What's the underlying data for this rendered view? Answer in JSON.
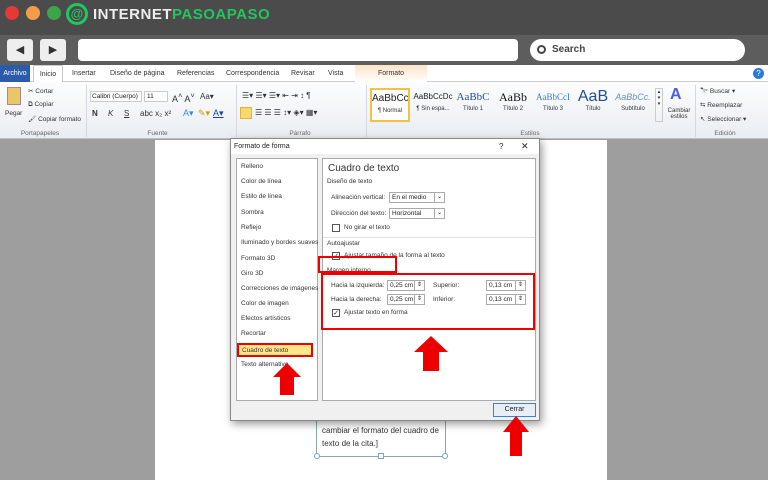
{
  "brand": {
    "logo_text_white": "INTERNET",
    "logo_text_green": "PASOAPASO",
    "green": "#22c55e"
  },
  "browser": {
    "search_label": "Search",
    "back_icon": "back-arrow-icon",
    "forward_icon": "forward-arrow-icon"
  },
  "ribbon_tabs": [
    "Archivo",
    "Inicio",
    "Insertar",
    "Diseño de página",
    "Referencias",
    "Correspondencia",
    "Revisar",
    "Vista",
    "Formato"
  ],
  "portapapeles": {
    "paste": "Pegar",
    "cut": "Cortar",
    "copy": "Copiar",
    "format_painter": "Copiar formato",
    "group": "Portapapeles"
  },
  "fuente": {
    "font": "Calibri (Cuerpo)",
    "size": "11",
    "bold": "N",
    "italic": "K",
    "underline": "S",
    "group": "Fuente"
  },
  "parrafo": {
    "group": "Párrafo"
  },
  "estilos": {
    "items": [
      {
        "sample": "AaBbCcDc",
        "label": "¶ Normal"
      },
      {
        "sample": "AaBbCcDc",
        "label": "¶ Sin espa..."
      },
      {
        "sample": "AaBbC",
        "label": "Título 1"
      },
      {
        "sample": "AaBb",
        "label": "Título 2"
      },
      {
        "sample": "AaBbCcI",
        "label": "Título 3"
      },
      {
        "sample": "AaB",
        "label": "Título"
      },
      {
        "sample": "AaBbCc.",
        "label": "Subtítulo"
      }
    ],
    "change": "Cambiar estilos",
    "group": "Estilos"
  },
  "edicion": {
    "find": "Buscar",
    "replace": "Reemplazar",
    "select": "Seleccionar",
    "group": "Edición"
  },
  "document": {
    "textbox_line1": "cambiar el formato del cuadro de",
    "textbox_line2": "texto de la cita.]"
  },
  "dialog": {
    "title": "Formato de forma",
    "help": "?",
    "close": "✕",
    "categories": [
      "Relleno",
      "Color de línea",
      "Estilo de línea",
      "Sombra",
      "Reflejo",
      "Iluminado y bordes suaves",
      "Formato 3D",
      "Giro 3D",
      "Correcciones de imágenes",
      "Color de imagen",
      "Efectos artísticos",
      "Recortar",
      "Cuadro de texto",
      "Texto alternativo"
    ],
    "selected": "Cuadro de texto",
    "panel_title": "Cuadro de texto",
    "design_section": "Diseño de texto",
    "vertical_align_label": "Alineación vertical:",
    "vertical_align_value": "En el medio",
    "direction_label": "Dirección del texto:",
    "direction_value": "Horizontal",
    "no_rotate": "No girar el texto",
    "no_rotate_checked": false,
    "autofit_section": "Autoajustar",
    "autofit_resize": "Ajustar tamaño de la forma al texto",
    "autofit_checked": true,
    "margin_section": "Margen interno",
    "left_label": "Hacia la izquierda:",
    "left_value": "0,25 cm",
    "right_label": "Hacia la derecha:",
    "right_value": "0,25 cm",
    "top_label": "Superior:",
    "top_value": "0,13 cm",
    "bottom_label": "Inferior:",
    "bottom_value": "0,13 cm",
    "wrap": "Ajustar texto en forma",
    "wrap_checked": true,
    "close_button": "Cerrar"
  },
  "annotation_color": "#e00000"
}
